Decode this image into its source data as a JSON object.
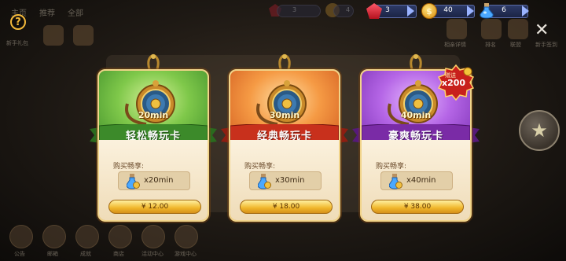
{
  "background": {
    "tabs": [
      "主页",
      "推荐",
      "全部"
    ],
    "left_icons": [
      {
        "label": "新手礼包"
      }
    ],
    "right_labels": [
      "相亲详情",
      "排名",
      "联盟",
      "新手签到"
    ],
    "bottom_labels": [
      "公告",
      "邮箱",
      "成就",
      "商店",
      "活动中心",
      "游戏中心"
    ],
    "dim_currency_values": [
      "3",
      "4"
    ]
  },
  "currency": {
    "gems": "3",
    "coins": "40",
    "potions": "6",
    "coin_symbol": "$"
  },
  "help_label": "?",
  "close_label": "✕",
  "side_button_icon": "star-orb-icon",
  "cards": [
    {
      "theme": "green",
      "minutes": "20min",
      "name": "轻松畅玩卡",
      "buy_label": "购买畅享:",
      "quantity": "x20min",
      "price": "¥ 12.00"
    },
    {
      "theme": "orange",
      "minutes": "30min",
      "name": "经典畅玩卡",
      "buy_label": "购买畅享:",
      "quantity": "x30min",
      "price": "¥ 18.00"
    },
    {
      "theme": "purple",
      "minutes": "40min",
      "name": "豪爽畅玩卡",
      "buy_label": "购买畅享:",
      "quantity": "x40min",
      "price": "¥ 38.00"
    }
  ],
  "bonus_badge": {
    "label": "赠送",
    "amount": "x200"
  },
  "colors": {
    "green_ribbon": "#3c8a2a",
    "orange_ribbon": "#c8301c",
    "purple_ribbon": "#7a2ba6",
    "price_button": "#f0b62a",
    "badge": "#c8201c"
  }
}
